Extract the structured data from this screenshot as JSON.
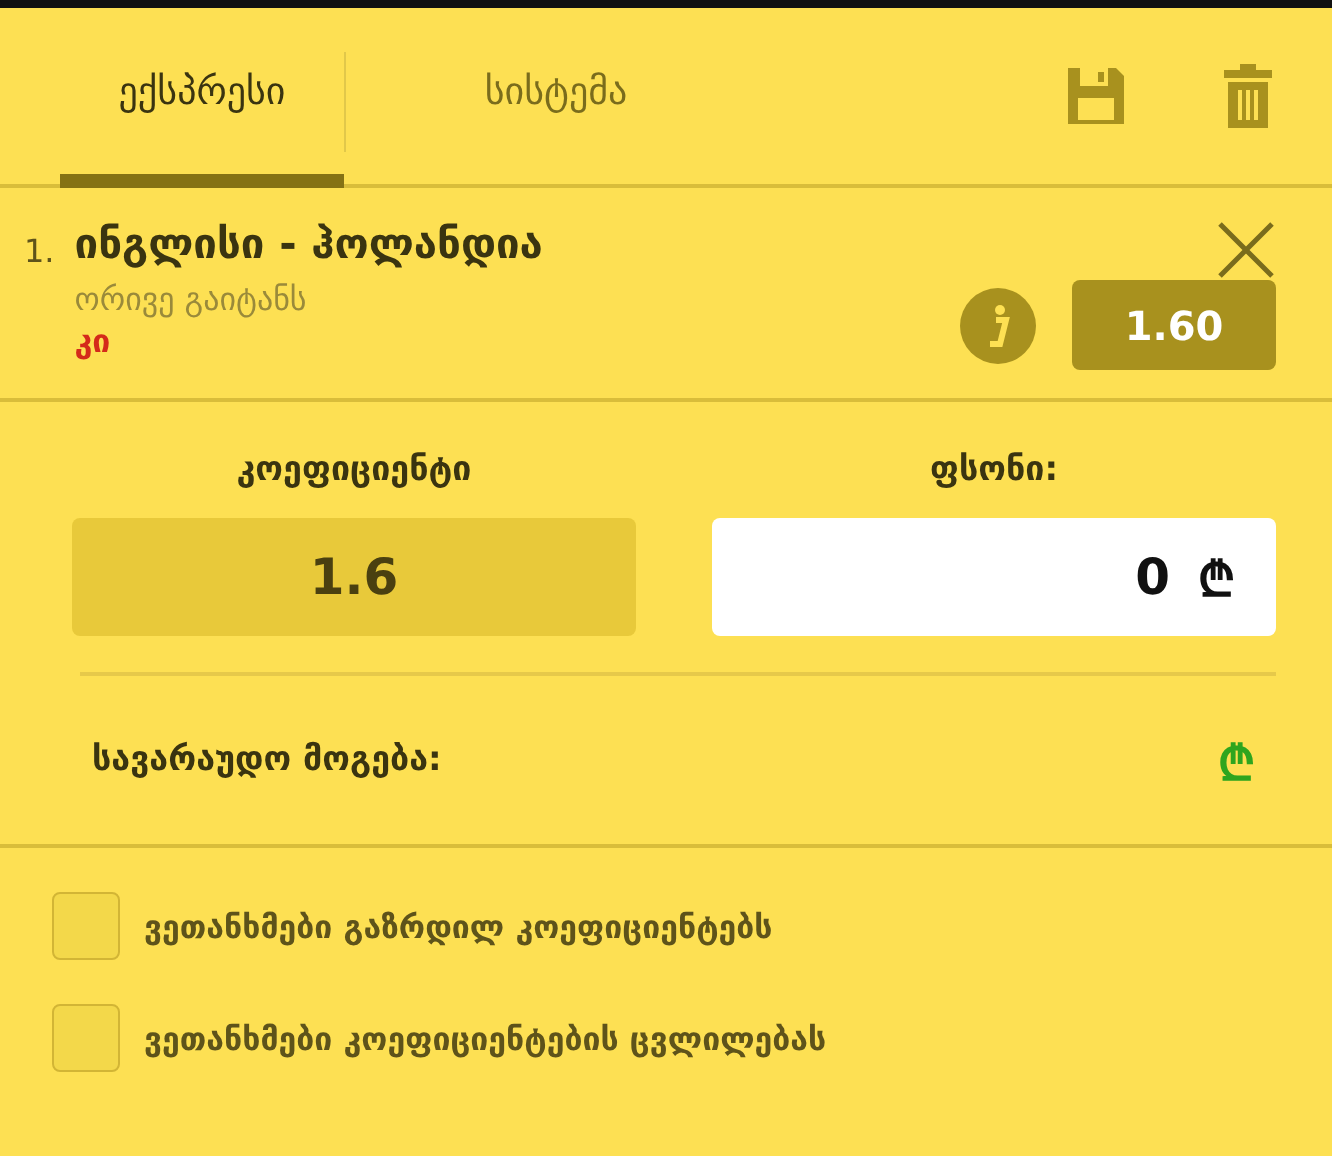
{
  "tabs": [
    {
      "label": "ექსპრესი",
      "selected": true
    },
    {
      "label": "სისტემა",
      "selected": false
    }
  ],
  "bet": {
    "number": "1.",
    "match": "ინგლისი - ჰოლანდია",
    "market": "ორივე გაიტანს",
    "pick": "კი",
    "odds": "1.60"
  },
  "coefficient": {
    "label": "კოეფიციენტი",
    "value": "1.6"
  },
  "stake": {
    "label": "ფსონი:",
    "value": "0",
    "currency": "₾"
  },
  "potential_win": {
    "label": "სავარაუდო მოგება:",
    "currency": "₾"
  },
  "options": [
    {
      "label": "ვეთანხმები გაზრდილ კოეფიციენტებს",
      "checked": false
    },
    {
      "label": "ვეთანხმები კოეფიციენტების ცვლილებას",
      "checked": false
    }
  ]
}
